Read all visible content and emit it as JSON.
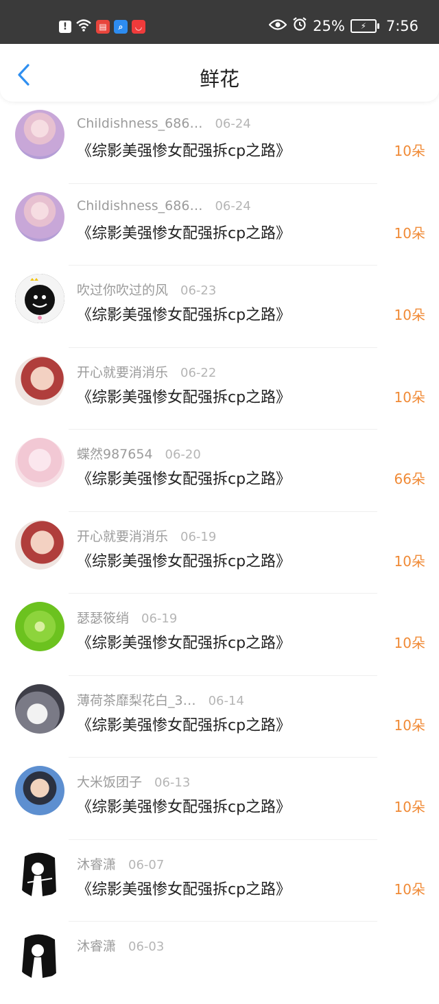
{
  "status_bar": {
    "battery": "25%",
    "time": "7:56",
    "app_icons": [
      {
        "name": "warning-icon",
        "color": "#ffffff"
      },
      {
        "name": "wifi-icon",
        "color": "#ffffff"
      },
      {
        "name": "book-app-icon",
        "color": "#e8453c"
      },
      {
        "name": "search-app-icon",
        "color": "#2d8cf0"
      },
      {
        "name": "shop-app-icon",
        "color": "#ef3b3b"
      }
    ]
  },
  "header": {
    "title": "鲜花",
    "back_icon": "chevron-left-icon",
    "accent": "#2f8ff0"
  },
  "items": [
    {
      "name": "Childishness_686…",
      "date": "06-24",
      "book": "《综影美强惨女配强拆cp之路》",
      "count": "10朵"
    },
    {
      "name": "Childishness_686…",
      "date": "06-24",
      "book": "《综影美强惨女配强拆cp之路》",
      "count": "10朵"
    },
    {
      "name": "吹过你吹过的风",
      "date": "06-23",
      "book": "《综影美强惨女配强拆cp之路》",
      "count": "10朵"
    },
    {
      "name": "开心就要消消乐",
      "date": "06-22",
      "book": "《综影美强惨女配强拆cp之路》",
      "count": "10朵"
    },
    {
      "name": "蝶然987654",
      "date": "06-20",
      "book": "《综影美强惨女配强拆cp之路》",
      "count": "66朵"
    },
    {
      "name": "开心就要消消乐",
      "date": "06-19",
      "book": "《综影美强惨女配强拆cp之路》",
      "count": "10朵"
    },
    {
      "name": "瑟瑟筱绡",
      "date": "06-19",
      "book": "《综影美强惨女配强拆cp之路》",
      "count": "10朵"
    },
    {
      "name": "薄荷茶靡梨花白_3…",
      "date": "06-14",
      "book": "《综影美强惨女配强拆cp之路》",
      "count": "10朵"
    },
    {
      "name": "大米饭团子",
      "date": "06-13",
      "book": "《综影美强惨女配强拆cp之路》",
      "count": "10朵"
    },
    {
      "name": "沐睿潇",
      "date": "06-07",
      "book": "《综影美强惨女配强拆cp之路》",
      "count": "10朵"
    },
    {
      "name": "沐睿潇",
      "date": "06-03",
      "book": "",
      "count": ""
    }
  ],
  "colors": {
    "count_orange": "#f08a36",
    "status_bar_bg": "#3a3a3a"
  }
}
